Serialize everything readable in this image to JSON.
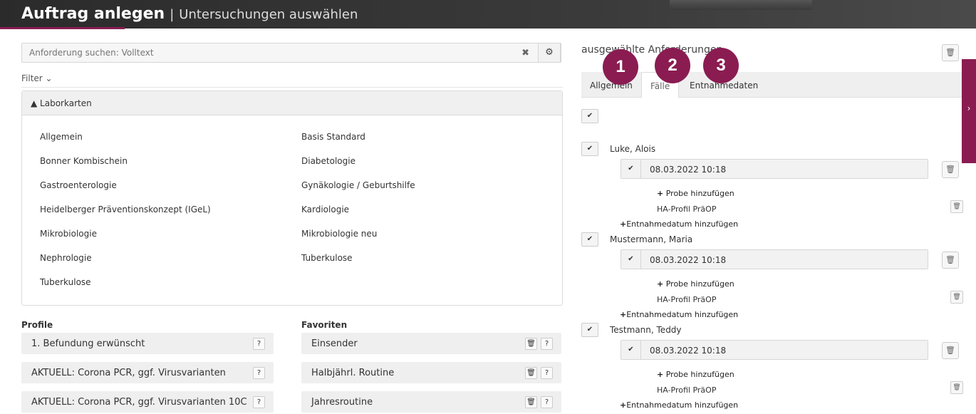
{
  "header": {
    "title": "Auftrag anlegen",
    "separator": "|",
    "subtitle": "Untersuchungen auswählen"
  },
  "search": {
    "placeholder": "Anforderung suchen: Volltext",
    "clear": "✖",
    "gear": "⚙"
  },
  "filter_label": "Filter ⌄",
  "laborkarten": {
    "title": "▲ Laborkarten",
    "col1": [
      "Allgemein",
      "Bonner Kombischein",
      "Gastroenterologie",
      "Heidelberger Präventionskonzept (IGeL)",
      "Mikrobiologie",
      "Nephrologie",
      "Tuberkulose"
    ],
    "col2": [
      "Basis Standard",
      "Diabetologie",
      "Gynäkologie / Geburtshilfe",
      "Kardiologie",
      "Mikrobiologie neu",
      "Tuberkulose"
    ]
  },
  "profile": {
    "title": "Profile",
    "items": [
      "1. Befundung erwünscht",
      "AKTUELL: Corona PCR, ggf. Virusvarianten",
      "AKTUELL: Corona PCR, ggf. Virusvarianten 10C"
    ]
  },
  "favoriten": {
    "title": "Favoriten",
    "items": [
      "Einsender",
      "Halbjährl. Routine",
      "Jahresroutine"
    ]
  },
  "right": {
    "heading": "ausgewählte Anforderungen",
    "tabs": [
      "Allgemein",
      "Fälle",
      "Entnahmedaten"
    ],
    "active_tab": "Fälle",
    "badges": [
      "1",
      "2",
      "3"
    ],
    "side_arrow": "›"
  },
  "cases": [
    {
      "name": "Luke, Alois",
      "date": "08.03.2022 10:18",
      "add_probe": "Probe hinzufügen",
      "profile": "HA-Profil PräOP",
      "add_entnahme": "Entnahmedatum hinzufügen"
    },
    {
      "name": "Mustermann, Maria",
      "date": "08.03.2022 10:18",
      "add_probe": "Probe hinzufügen",
      "profile": "HA-Profil PräOP",
      "add_entnahme": "Entnahmedatum hinzufügen"
    },
    {
      "name": "Testmann, Teddy",
      "date": "08.03.2022 10:18",
      "add_probe": "Probe hinzufügen",
      "profile": "HA-Profil PräOP",
      "add_entnahme": "Entnahmedatum hinzufügen"
    }
  ],
  "icons": {
    "check": "✔",
    "trash": "🗑",
    "help": "?",
    "plus": "+"
  },
  "colors": {
    "accent": "#8a1c52",
    "topbar": "#333333"
  }
}
